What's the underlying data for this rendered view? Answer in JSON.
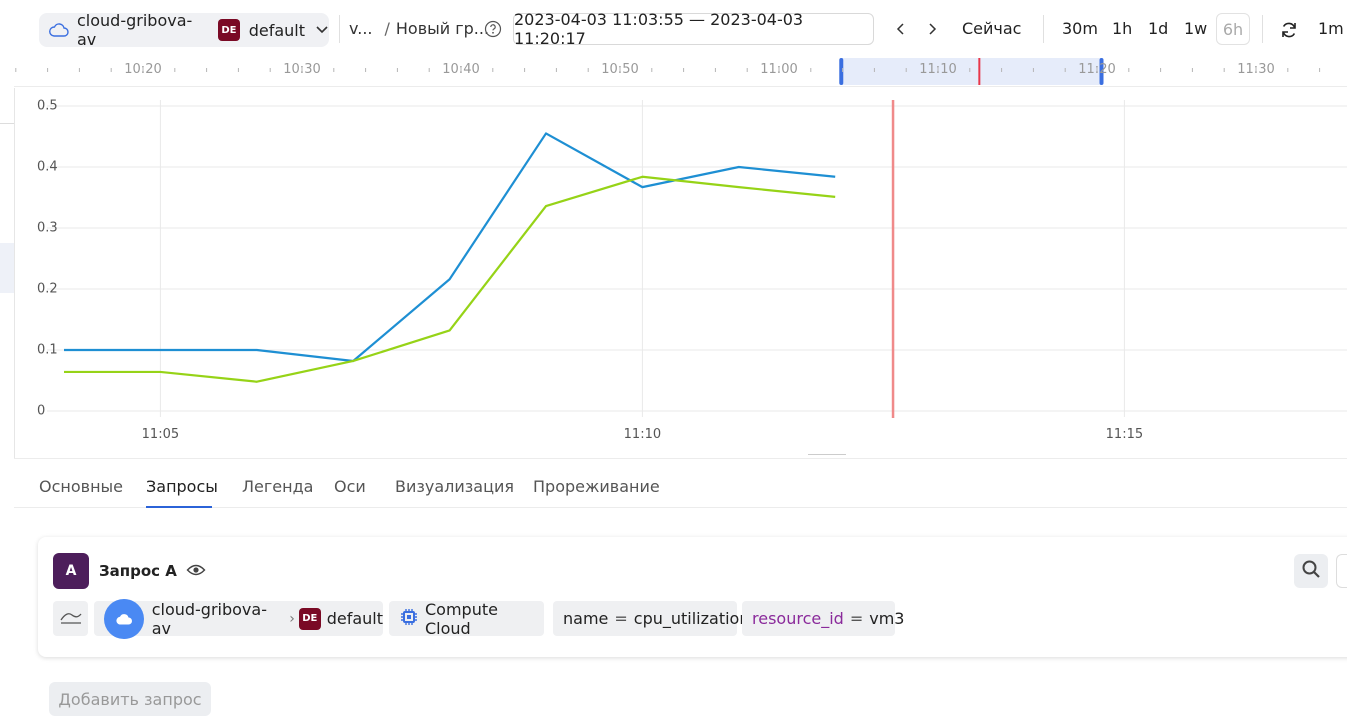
{
  "topbar": {
    "cloud_name": "cloud-gribova-av",
    "folder_badge": "DE",
    "folder_name": "default",
    "breadcrumb_root": "v...",
    "breadcrumb_page": "Новый гр...",
    "date_range": "2023-04-03 11:03:55 — 2023-04-03 11:20:17",
    "now_label": "Сейчас",
    "ranges": [
      "30m",
      "1h",
      "1d",
      "1w"
    ],
    "range_disabled": "6h",
    "refresh_interval": "1m"
  },
  "timeline": {
    "labels": [
      "10:20",
      "10:30",
      "10:40",
      "10:50",
      "11:00",
      "11:10",
      "11:20",
      "11:30"
    ]
  },
  "chart_data": {
    "type": "line",
    "x": [
      "11:04",
      "11:05",
      "11:06",
      "11:07",
      "11:08",
      "11:09",
      "11:10",
      "11:11",
      "11:12"
    ],
    "series": [
      {
        "color": "#1e8fd3",
        "values": [
          0.1,
          0.1,
          0.1,
          0.082,
          0.216,
          0.455,
          0.367,
          0.4,
          0.384
        ]
      },
      {
        "color": "#96d317",
        "values": [
          0.064,
          0.064,
          0.048,
          0.082,
          0.132,
          0.336,
          0.384,
          0.367,
          0.351
        ]
      }
    ],
    "ylim": [
      0,
      0.5
    ],
    "yticks": [
      "0",
      "0.1",
      "0.2",
      "0.3",
      "0.4",
      "0.5"
    ],
    "xticks": [
      "11:05",
      "11:10",
      "11:15"
    ],
    "current_time_marker": "11:12.6",
    "grid": true
  },
  "tabs": [
    "Основные",
    "Запросы",
    "Легенда",
    "Оси",
    "Визуализация",
    "Прореживание"
  ],
  "active_tab": "Запросы",
  "query": {
    "letter": "A",
    "title": "Запрос A",
    "cloud": "cloud-gribova-av",
    "folder_badge": "DE",
    "folder": "default",
    "service": "Compute Cloud",
    "label1_key": "name",
    "label1_op": "=",
    "label1_value": "cpu_utilization",
    "label2_key": "resource_id",
    "label2_op": "=",
    "label2_value": "vm3"
  },
  "add_query_label": "Добавить запрос"
}
